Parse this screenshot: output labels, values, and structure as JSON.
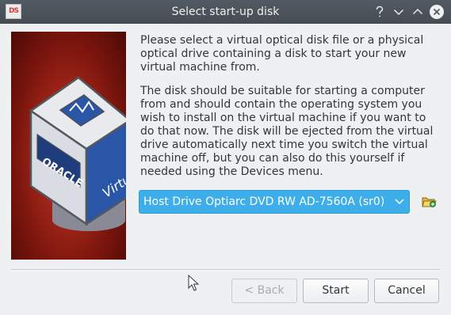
{
  "window": {
    "title": "Select start-up disk",
    "app_icon_text": "DS"
  },
  "watermark": {
    "brand_text": "ORACLE",
    "side_text": "Virtual"
  },
  "intro_text": "Please select a virtual optical disk file or a physical optical drive containing a disk to start your new virtual machine from.",
  "description_text": "The disk should be suitable for starting a computer from and should contain the operating system you wish to install on the virtual machine if you want to do that now. The disk will be ejected from the virtual drive automatically next time you switch the virtual machine off, but you can also do this yourself if needed using the Devices menu.",
  "drive_select": {
    "selected": "Host Drive Optiarc DVD RW AD-7560A  (sr0)"
  },
  "buttons": {
    "back": "< Back",
    "start": "Start",
    "cancel": "Cancel"
  },
  "colors": {
    "titlebar": "#4d555d",
    "accent": "#3daee9",
    "window_bg": "#eff0f1",
    "text": "#31363b"
  },
  "icons": {
    "help": "help-icon",
    "minimize": "minimize-icon",
    "maximize": "maximize-icon",
    "close": "close-icon",
    "folder": "folder-open-icon",
    "dropdown": "chevron-down-icon"
  }
}
